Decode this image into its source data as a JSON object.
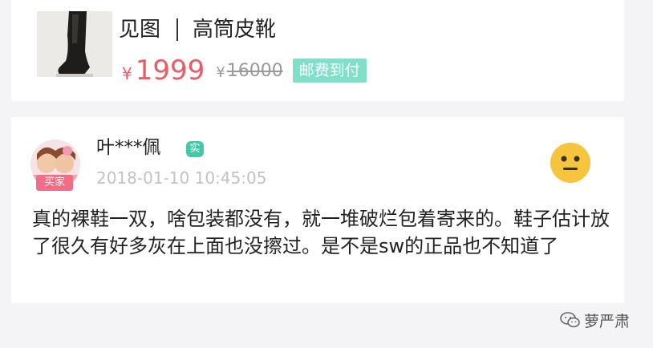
{
  "product": {
    "title_prefix": "见图",
    "title": "高筒皮靴",
    "currency": "¥",
    "price": "1999",
    "original_currency": "¥",
    "original_price": "16000",
    "shipping_tag": "邮费到付"
  },
  "review": {
    "buyer_tag": "买家",
    "user_name": "叶***佩",
    "verified_badge": "实",
    "time": "2018-01-10 10:45:05",
    "mood_icon": "neutral-face-icon",
    "text": "真的裸鞋一双，啥包装都没有，就一堆破烂包着寄来的。鞋子估计放了很久有好多灰在上面也没擦过。是不是sw的正品也不知道了"
  },
  "watermark": {
    "text": "萝严肃"
  },
  "colors": {
    "price_red": "#e95b66",
    "shipping_green": "#7fe0c9",
    "badge_green": "#44c9a6",
    "buyer_pink": "#f06d85",
    "emoji_yellow": "#f7c43e"
  }
}
